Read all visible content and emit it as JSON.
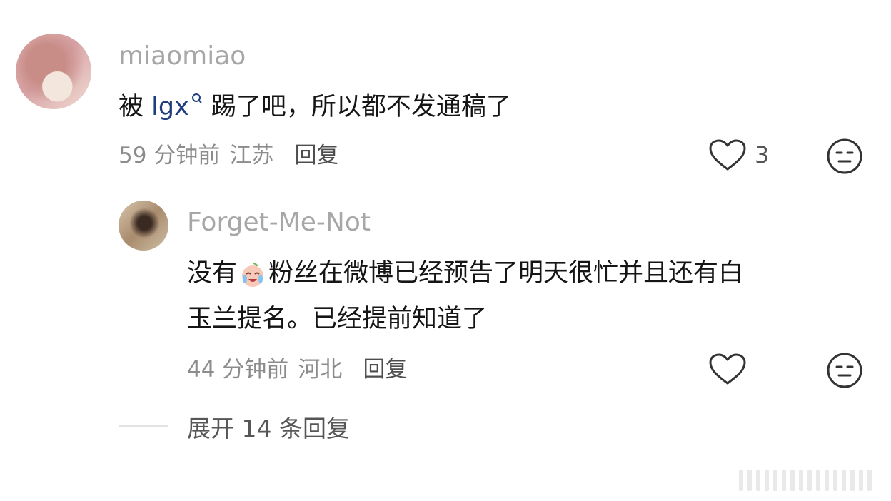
{
  "comments": [
    {
      "username": "miaomiao",
      "text_before": "被 ",
      "mention": "lgx",
      "text_after": " 踢了吧，所以都不发通稿了",
      "time": "59 分钟前",
      "location": "江苏",
      "reply_label": "回复",
      "like_count": "3"
    }
  ],
  "replies": [
    {
      "username": "Forget-Me-Not",
      "text_before": "没有",
      "text_after": "粉丝在微博已经预告了明天很忙并且还有白",
      "text_line2": "玉兰提名。已经提前知道了",
      "time": "44 分钟前",
      "location": "河北",
      "reply_label": "回复"
    }
  ],
  "expand_label": "展开 14 条回复",
  "icons": {
    "like": "heart-outline-icon",
    "emoji": "neutral-face-icon",
    "search": "search-icon",
    "crying": "crying-laughing-emoji"
  }
}
